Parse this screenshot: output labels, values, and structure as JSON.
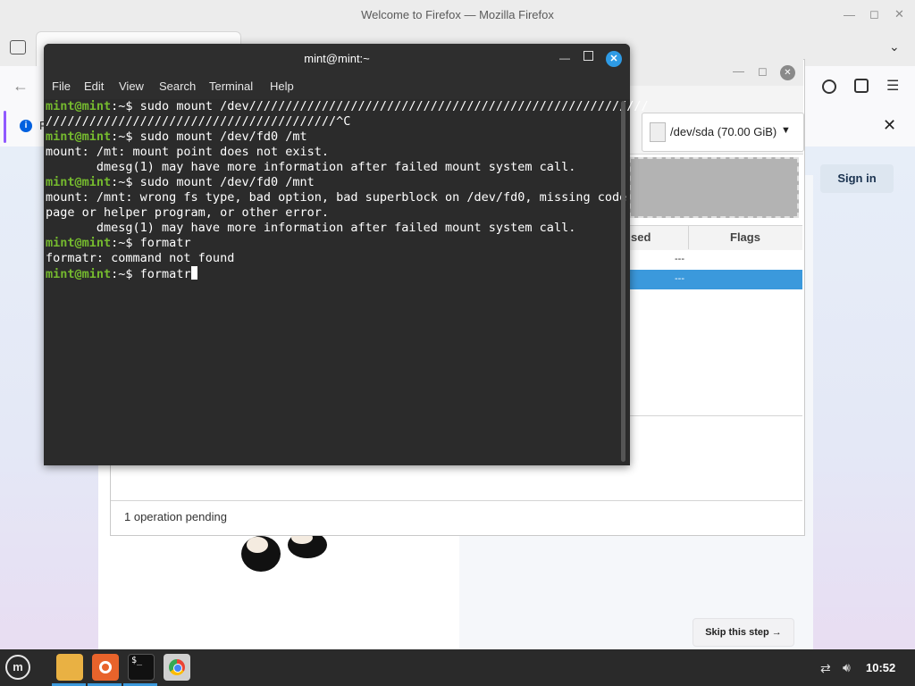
{
  "firefox": {
    "window_title": "Welcome to Firefox — Mozilla Firefox",
    "info_letter": "F",
    "sign_in": "Sign in",
    "skip_step": "Skip this step →"
  },
  "gparted": {
    "device": "/dev/sda (70.00 GiB)",
    "columns": [
      "sed",
      "Flags"
    ],
    "rows": [
      {
        "flags": "---"
      },
      {
        "flags": "---"
      }
    ],
    "status": "1 operation pending"
  },
  "terminal": {
    "title": "mint@mint:~",
    "menu": [
      "File",
      "Edit",
      "View",
      "Search",
      "Terminal",
      "Help"
    ],
    "prompt_user": "mint@mint",
    "prompt_path": ":~$",
    "lines": [
      {
        "type": "cmd",
        "text": " sudo mount /dev///////////////////////////////////////////////////////"
      },
      {
        "type": "out",
        "text": "////////////////////////////////////////^C"
      },
      {
        "type": "cmd",
        "text": " sudo mount /dev/fd0 /mt"
      },
      {
        "type": "out",
        "text": "mount: /mt: mount point does not exist."
      },
      {
        "type": "out",
        "text": "       dmesg(1) may have more information after failed mount system call."
      },
      {
        "type": "cmd",
        "text": " sudo mount /dev/fd0 /mnt"
      },
      {
        "type": "out",
        "text": "mount: /mnt: wrong fs type, bad option, bad superblock on /dev/fd0, missing code"
      },
      {
        "type": "out",
        "text": "page or helper program, or other error."
      },
      {
        "type": "out",
        "text": "       dmesg(1) may have more information after failed mount system call."
      },
      {
        "type": "cmd",
        "text": " formatr"
      },
      {
        "type": "out",
        "text": "formatr: command not found"
      },
      {
        "type": "cmd",
        "text": " formatr"
      }
    ]
  },
  "taskbar": {
    "clock": "10:52",
    "apps": [
      "menu-icon",
      "files-icon",
      "firefox-icon",
      "terminal-icon",
      "chrome-icon"
    ]
  },
  "colors": {
    "prompt_green": "#75ba2e",
    "selection_blue": "#3b99dc",
    "taskbar": "#2a2a2a"
  }
}
